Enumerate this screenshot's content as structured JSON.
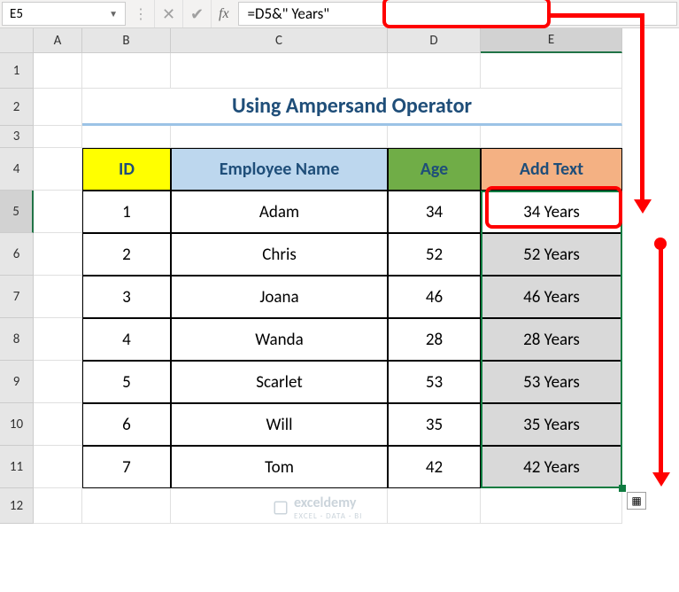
{
  "namebox": "E5",
  "formula": "=D5&\" Years\"",
  "fx_label": "fx",
  "columns": {
    "A": "A",
    "B": "B",
    "C": "C",
    "D": "D",
    "E": "E"
  },
  "rows": [
    "1",
    "2",
    "3",
    "4",
    "5",
    "6",
    "7",
    "8",
    "9",
    "10",
    "11",
    "12"
  ],
  "title": "Using Ampersand Operator",
  "headers": {
    "id": "ID",
    "name": "Employee Name",
    "age": "Age",
    "add": "Add Text"
  },
  "data": [
    {
      "id": "1",
      "name": "Adam",
      "age": "34",
      "text": "34 Years"
    },
    {
      "id": "2",
      "name": "Chris",
      "age": "52",
      "text": "52 Years"
    },
    {
      "id": "3",
      "name": "Joana",
      "age": "46",
      "text": "46 Years"
    },
    {
      "id": "4",
      "name": "Wanda",
      "age": "28",
      "text": "28 Years"
    },
    {
      "id": "5",
      "name": "Scarlet",
      "age": "53",
      "text": "53 Years"
    },
    {
      "id": "6",
      "name": "Will",
      "age": "35",
      "text": "35 Years"
    },
    {
      "id": "7",
      "name": "Tom",
      "age": "42",
      "text": "42 Years"
    }
  ],
  "watermark": {
    "brand": "exceldemy",
    "tag": "EXCEL · DATA · BI"
  }
}
